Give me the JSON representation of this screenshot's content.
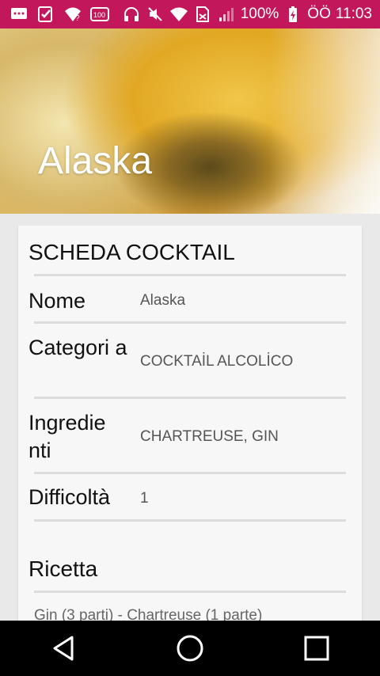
{
  "status_bar": {
    "battery_text": "100%",
    "extra_text": "ÖÖ",
    "time": "11:03",
    "icons_left": [
      "message-icon",
      "checklist-icon",
      "wifi-question-icon",
      "badge-100-icon"
    ],
    "icons_right": [
      "headphones-icon",
      "mute-icon",
      "wifi-icon",
      "sim-icon",
      "signal-icon",
      "battery-charging-icon"
    ],
    "color": "#c2185b"
  },
  "hero": {
    "title": "Alaska"
  },
  "card": {
    "header": "SCHEDA COCKTAIL",
    "rows": [
      {
        "label": "Nome",
        "value": "Alaska"
      },
      {
        "label": "Categori a",
        "value": "COCKTAİL ALCOLİCO"
      },
      {
        "label": "Ingredie nti",
        "value": "CHARTREUSE, GIN"
      },
      {
        "label": "Difficoltà",
        "value": "1"
      }
    ],
    "recipe_title": "Ricetta",
    "recipe_text": "Gin (3 parti) - Chartreuse (1 parte)"
  },
  "nav": {
    "icons": [
      "back-icon",
      "home-icon",
      "recents-icon"
    ]
  }
}
